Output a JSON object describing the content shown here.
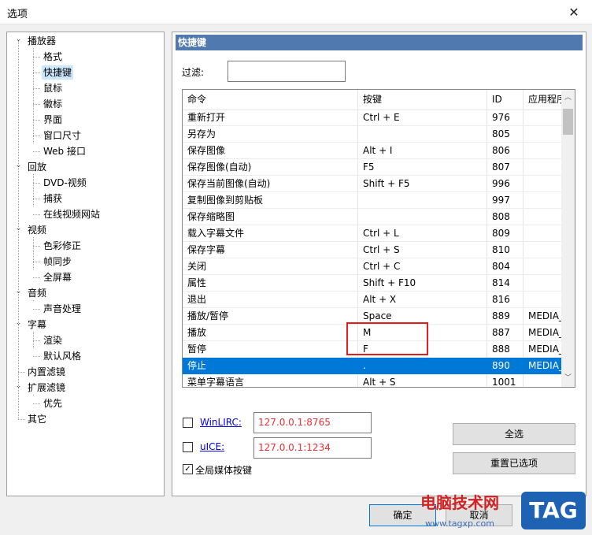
{
  "window": {
    "title": "选项"
  },
  "tree": {
    "nodes": [
      {
        "label": "播放器",
        "level": 0,
        "expanded": true
      },
      {
        "label": "格式",
        "level": 1
      },
      {
        "label": "快捷键",
        "level": 1,
        "selected": true
      },
      {
        "label": "鼠标",
        "level": 1
      },
      {
        "label": "徽标",
        "level": 1
      },
      {
        "label": "界面",
        "level": 1
      },
      {
        "label": "窗口尺寸",
        "level": 1
      },
      {
        "label": "Web 接口",
        "level": 1
      },
      {
        "label": "回放",
        "level": 0,
        "expanded": true
      },
      {
        "label": "DVD-视频",
        "level": 1
      },
      {
        "label": "捕获",
        "level": 1
      },
      {
        "label": "在线视频网站",
        "level": 1
      },
      {
        "label": "视频",
        "level": 0,
        "expanded": true
      },
      {
        "label": "色彩修正",
        "level": 1
      },
      {
        "label": "帧同步",
        "level": 1
      },
      {
        "label": "全屏幕",
        "level": 1
      },
      {
        "label": "音频",
        "level": 0,
        "expanded": true
      },
      {
        "label": "声音处理",
        "level": 1
      },
      {
        "label": "字幕",
        "level": 0,
        "expanded": true
      },
      {
        "label": "渲染",
        "level": 1
      },
      {
        "label": "默认风格",
        "level": 1
      },
      {
        "label": "内置滤镜",
        "level": 0
      },
      {
        "label": "扩展滤镜",
        "level": 0,
        "expanded": true
      },
      {
        "label": "优先",
        "level": 1
      },
      {
        "label": "其它",
        "level": 0
      }
    ]
  },
  "panel": {
    "header": "快捷键",
    "filter_label": "过滤:",
    "filter_value": "",
    "columns": [
      "命令",
      "按键",
      "ID",
      "应用程序"
    ],
    "rows": [
      {
        "cmd": "重新打开",
        "key": "Ctrl + E",
        "id": "976",
        "app": ""
      },
      {
        "cmd": "另存为",
        "key": "",
        "id": "805",
        "app": ""
      },
      {
        "cmd": "保存图像",
        "key": "Alt + I",
        "id": "806",
        "app": ""
      },
      {
        "cmd": "保存图像(自动)",
        "key": "F5",
        "id": "807",
        "app": ""
      },
      {
        "cmd": "保存当前图像(自动)",
        "key": "Shift + F5",
        "id": "996",
        "app": ""
      },
      {
        "cmd": "复制图像到剪贴板",
        "key": "",
        "id": "997",
        "app": ""
      },
      {
        "cmd": "保存缩略图",
        "key": "",
        "id": "808",
        "app": ""
      },
      {
        "cmd": "载入字幕文件",
        "key": "Ctrl + L",
        "id": "809",
        "app": ""
      },
      {
        "cmd": "保存字幕",
        "key": "Ctrl + S",
        "id": "810",
        "app": ""
      },
      {
        "cmd": "关闭",
        "key": "Ctrl + C",
        "id": "804",
        "app": ""
      },
      {
        "cmd": "属性",
        "key": "Shift + F10",
        "id": "814",
        "app": ""
      },
      {
        "cmd": "退出",
        "key": "Alt + X",
        "id": "816",
        "app": ""
      },
      {
        "cmd": "播放/暂停",
        "key": "Space",
        "id": "889",
        "app": "MEDIA_"
      },
      {
        "cmd": "播放",
        "key": "M",
        "id": "887",
        "app": "MEDIA_"
      },
      {
        "cmd": "暂停",
        "key": "F",
        "id": "888",
        "app": "MEDIA_"
      },
      {
        "cmd": "停止",
        "key": ".",
        "id": "890",
        "app": "MEDIA_",
        "selected": true
      },
      {
        "cmd": "菜单字幕语言",
        "key": "Alt + S",
        "id": "1001",
        "app": ""
      }
    ],
    "winlirc": {
      "label": "WinLIRC:",
      "value": "127.0.0.1:8765",
      "checked": false
    },
    "uice": {
      "label": "uICE:",
      "value": "127.0.0.1:1234",
      "checked": false
    },
    "global_media": {
      "label": "全局媒体按键",
      "checked": true
    },
    "select_all": "全选",
    "reset": "重置已选项"
  },
  "footer": {
    "ok": "确定",
    "cancel": "取消"
  },
  "watermark": {
    "line1": "电脑技术网",
    "line2": "www.tagxp.com",
    "logo": "TAG"
  },
  "colors": {
    "selection": "#0078d7",
    "header": "#5079b0",
    "highlight_box": "#e02020",
    "ip_text": "#e83030"
  }
}
